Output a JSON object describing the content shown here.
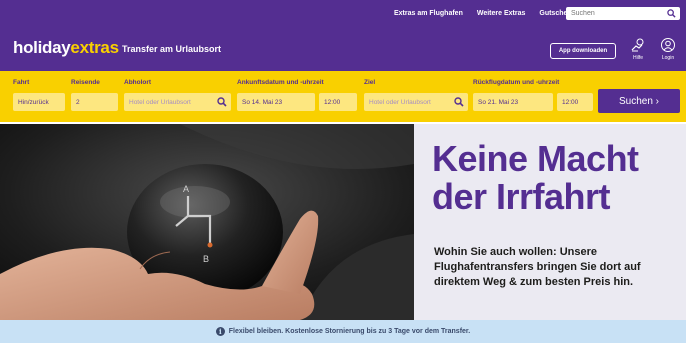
{
  "topbar": {
    "links": [
      "Extras am Flughafen",
      "Weitere Extras",
      "Gutschein"
    ],
    "search_placeholder": "Suchen"
  },
  "brand": {
    "logo_part1": "holiday",
    "logo_part2": "extras",
    "subtitle": "Transfer am Urlaubsort",
    "app_button": "App downloaden",
    "help_label": "Hilfe",
    "login_label": "Login"
  },
  "search_form": {
    "labels": {
      "trip": "Fahrt",
      "travellers": "Reisende",
      "pickup": "Abholort",
      "arrival": "Ankunftsdatum und -uhrzeit",
      "destination": "Ziel",
      "return": "Rückflugdatum und -uhrzeit"
    },
    "trip_value": "Hin/zurück",
    "travellers_value": "2",
    "pickup_placeholder": "Hotel oder Urlaubsort",
    "arrival_date": "So 14. Mai 23",
    "arrival_time": "12:00",
    "destination_placeholder": "Hotel oder Urlaubsort",
    "return_date": "So 21. Mai 23",
    "return_time": "12:00",
    "search_button": "Suchen ›"
  },
  "hero": {
    "headline": "Keine Macht der Irrfahrt",
    "subline": "Wohin Sie auch wollen: Unsere Flughafentransfers bringen Sie dort auf direktem Weg & zum besten Preis hin.",
    "knob_labels": [
      "A",
      "B"
    ]
  },
  "notice": {
    "text": "Flexibel bleiben. Kostenlose Stornierung bis zu 3 Tage vor dem Transfer."
  },
  "colors": {
    "brand_purple": "#542e91",
    "brand_yellow": "#f9d000",
    "hero_bg": "#ebeaf2",
    "notice_bg": "#c8e1f5"
  }
}
